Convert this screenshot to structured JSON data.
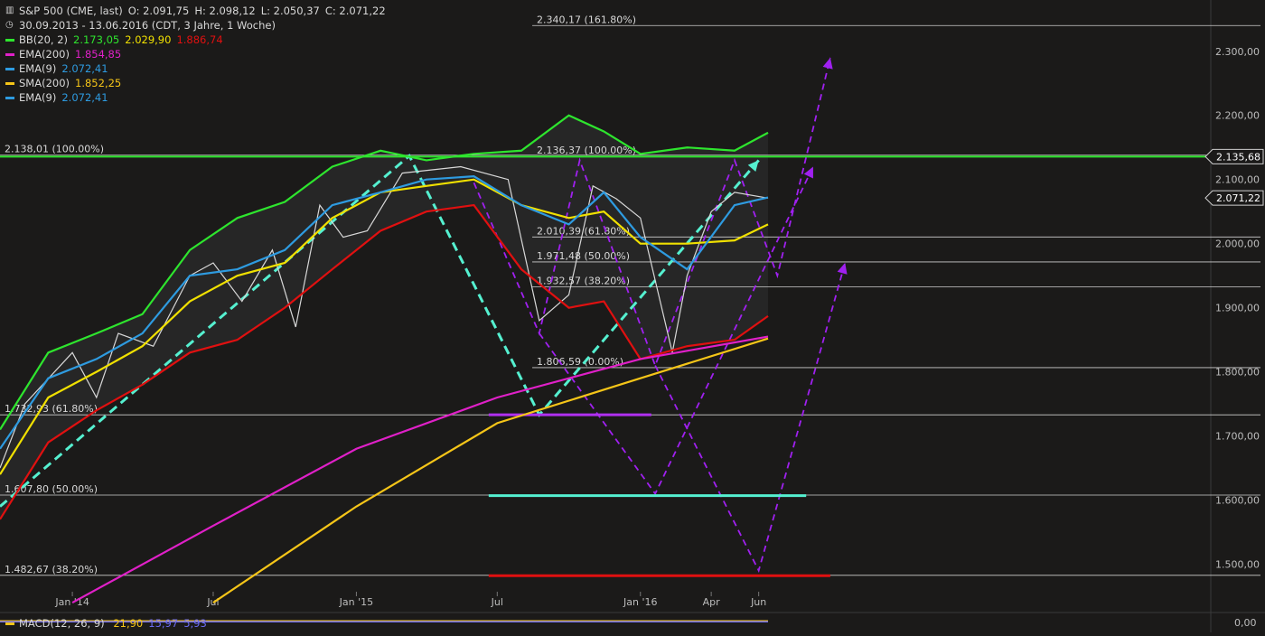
{
  "header": {
    "title": "S&P 500 (CME, last)",
    "ohlc": {
      "open": "O: 2.091,75",
      "high": "H: 2.098,12",
      "low": "L: 2.050,37",
      "close": "C: 2.071,22"
    },
    "range": "30.09.2013 - 13.06.2016 (CDT, 3 Jahre, 1 Woche)"
  },
  "legend": [
    {
      "label": "BB(20, 2)",
      "values": [
        "2.173,05",
        "2.029,90",
        "1.886,74"
      ],
      "colors": [
        "#2ee52e",
        "#f0e000",
        "#e01010"
      ]
    },
    {
      "label": "EMA(200)",
      "values": [
        "1.854,85"
      ],
      "colors": [
        "#e020c8"
      ]
    },
    {
      "label": "EMA(9)",
      "values": [
        "2.072,41"
      ],
      "colors": [
        "#2e9be0"
      ]
    },
    {
      "label": "SMA(200)",
      "values": [
        "1.852,25"
      ],
      "colors": [
        "#f5c518"
      ]
    },
    {
      "label": "EMA(9)",
      "values": [
        "2.072,41"
      ],
      "colors": [
        "#2e9be0"
      ]
    }
  ],
  "macd": {
    "label": "MACD(12, 26, 9)",
    "values": [
      "21,90",
      "15,97",
      "5,93"
    ],
    "colors": [
      "#f5c518",
      "#6b6bf0",
      "#6b6bf0"
    ],
    "axis_label": "0,00"
  },
  "chart_data": {
    "type": "line",
    "title": "S&P 500 (CME, last)",
    "period": "30.09.2013 - 13.06.2016",
    "ylim": [
      1450,
      2380
    ],
    "y_ticks": [
      1500,
      1600,
      1700,
      1800,
      1900,
      2000,
      2100,
      2200,
      2300
    ],
    "y_tick_labels": [
      "1.500,00",
      "1.600,00",
      "1.700,00",
      "1.800,00",
      "1.900,00",
      "2.000,00",
      "2.100,00",
      "2.200,00",
      "2.300,00"
    ],
    "x_ticks": [
      "2014-01-01",
      "2014-07-01",
      "2015-01-01",
      "2015-07-01",
      "2016-01-01",
      "2016-04-01",
      "2016-06-01"
    ],
    "x_tick_labels": [
      "Jan '14",
      "Jul",
      "Jan '15",
      "Jul",
      "Jan '16",
      "Apr",
      "Jun"
    ],
    "xlim": [
      "2013-09-30",
      "2016-06-13"
    ],
    "price_markers": [
      {
        "value": 2135.68,
        "label": "2.135,68",
        "color": "#2ee52e"
      },
      {
        "value": 2071.22,
        "label": "2.071,22",
        "color": "#d8d8d8"
      }
    ],
    "fib_levels": [
      {
        "value": 2340.17,
        "label": "2.340,17 (161.80%)",
        "start": "2015-08-15"
      },
      {
        "value": 2138.01,
        "label": "2.138,01 (100.00%)",
        "start": "2013-09-30"
      },
      {
        "value": 2136.37,
        "label": "2.136,37 (100.00%)",
        "start": "2015-08-15"
      },
      {
        "value": 2010.39,
        "label": "2.010,39 (61.80%)",
        "start": "2015-08-15"
      },
      {
        "value": 1971.48,
        "label": "1.971,48 (50.00%)",
        "start": "2015-08-15"
      },
      {
        "value": 1932.57,
        "label": "1.932,57 (38.20%)",
        "start": "2015-08-15"
      },
      {
        "value": 1806.59,
        "label": "1.806,59 (0.00%)",
        "start": "2015-08-15"
      },
      {
        "value": 1732.93,
        "label": "1.732,93 (61.80%)",
        "start": "2013-09-30"
      },
      {
        "value": 1607.8,
        "label": "1.607,80 (50.00%)",
        "start": "2013-09-30"
      },
      {
        "value": 1482.67,
        "label": "1.482,67 (38.20%)",
        "start": "2013-09-30"
      }
    ],
    "series": [
      {
        "name": "S&P 500 (CME, last)",
        "color": "#d8d8d8",
        "x": [
          "2013-09-30",
          "2013-11-01",
          "2014-01-01",
          "2014-02-01",
          "2014-03-01",
          "2014-04-15",
          "2014-06-01",
          "2014-07-01",
          "2014-08-07",
          "2014-09-15",
          "2014-10-15",
          "2014-11-15",
          "2014-12-15",
          "2015-01-15",
          "2015-03-01",
          "2015-05-15",
          "2015-07-15",
          "2015-08-24",
          "2015-10-01",
          "2015-11-01",
          "2015-12-01",
          "2016-01-01",
          "2016-02-11",
          "2016-03-01",
          "2016-04-01",
          "2016-05-01",
          "2016-06-13"
        ],
        "values": [
          1650,
          1750,
          1830,
          1760,
          1860,
          1840,
          1950,
          1970,
          1910,
          1990,
          1870,
          2060,
          2010,
          2020,
          2110,
          2120,
          2100,
          1880,
          1920,
          2090,
          2070,
          2040,
          1830,
          1950,
          2050,
          2080,
          2071
        ]
      },
      {
        "name": "BB(20, 2)",
        "color": "#2ee52e",
        "x": [
          "2013-09-30",
          "2013-12-01",
          "2014-02-01",
          "2014-04-01",
          "2014-06-01",
          "2014-08-01",
          "2014-10-01",
          "2014-12-01",
          "2015-02-01",
          "2015-04-01",
          "2015-06-01",
          "2015-08-01",
          "2015-10-01",
          "2015-11-15",
          "2016-01-01",
          "2016-03-01",
          "2016-05-01",
          "2016-06-13"
        ],
        "values": [
          1710,
          1830,
          1860,
          1890,
          1990,
          2040,
          2065,
          2120,
          2145,
          2130,
          2140,
          2145,
          2200,
          2175,
          2140,
          2150,
          2145,
          2173
        ]
      },
      {
        "name": "BB(20, 2)",
        "color": "#f0e000",
        "x": [
          "2013-09-30",
          "2013-12-01",
          "2014-02-01",
          "2014-04-01",
          "2014-06-01",
          "2014-08-01",
          "2014-10-01",
          "2014-12-01",
          "2015-02-01",
          "2015-04-01",
          "2015-06-01",
          "2015-08-01",
          "2015-10-01",
          "2015-11-15",
          "2016-01-01",
          "2016-03-01",
          "2016-05-01",
          "2016-06-13"
        ],
        "values": [
          1640,
          1760,
          1800,
          1840,
          1910,
          1950,
          1970,
          2040,
          2080,
          2090,
          2100,
          2060,
          2040,
          2050,
          2000,
          2000,
          2005,
          2030
        ]
      },
      {
        "name": "BB(20, 2)",
        "color": "#e01010",
        "x": [
          "2013-09-30",
          "2013-12-01",
          "2014-02-01",
          "2014-04-01",
          "2014-06-01",
          "2014-08-01",
          "2014-10-01",
          "2014-12-01",
          "2015-02-01",
          "2015-04-01",
          "2015-06-01",
          "2015-08-01",
          "2015-10-01",
          "2015-11-15",
          "2016-01-01",
          "2016-03-01",
          "2016-05-01",
          "2016-06-13"
        ],
        "values": [
          1570,
          1690,
          1740,
          1780,
          1830,
          1850,
          1900,
          1960,
          2020,
          2050,
          2060,
          1960,
          1900,
          1910,
          1820,
          1840,
          1850,
          1887
        ]
      },
      {
        "name": "EMA(9)",
        "color": "#2e9be0",
        "x": [
          "2013-09-30",
          "2013-12-01",
          "2014-02-01",
          "2014-04-01",
          "2014-06-01",
          "2014-08-01",
          "2014-10-01",
          "2014-12-01",
          "2015-02-01",
          "2015-04-01",
          "2015-06-01",
          "2015-08-01",
          "2015-10-01",
          "2015-11-15",
          "2016-01-01",
          "2016-03-01",
          "2016-05-01",
          "2016-06-13"
        ],
        "values": [
          1680,
          1790,
          1820,
          1860,
          1950,
          1960,
          1990,
          2060,
          2080,
          2100,
          2105,
          2060,
          2030,
          2080,
          2010,
          1960,
          2060,
          2072
        ]
      },
      {
        "name": "EMA(200)",
        "color": "#e020c8",
        "x": [
          "2014-01-01",
          "2014-07-01",
          "2015-01-01",
          "2015-07-01",
          "2016-01-01",
          "2016-06-13"
        ],
        "values": [
          1440,
          1560,
          1680,
          1760,
          1820,
          1855
        ]
      },
      {
        "name": "SMA(200)",
        "color": "#f5c518",
        "x": [
          "2014-07-01",
          "2015-01-01",
          "2015-07-01",
          "2016-01-01",
          "2016-06-13"
        ],
        "values": [
          1440,
          1590,
          1720,
          1790,
          1852
        ]
      }
    ],
    "drawings": [
      {
        "kind": "channel",
        "color": "#55f0d0",
        "points": [
          [
            "2013-09-30",
            1590
          ],
          [
            "2015-03-10",
            2137
          ],
          [
            "2015-08-24",
            1733
          ],
          [
            "2016-06-01",
            2130
          ]
        ]
      },
      {
        "kind": "path",
        "color": "#a020f0",
        "points": [
          [
            "2015-06-01",
            2095
          ],
          [
            "2015-08-24",
            1860
          ],
          [
            "2015-10-15",
            2130
          ],
          [
            "2016-01-20",
            1810
          ],
          [
            "2016-05-01",
            2130
          ],
          [
            "2016-06-25",
            1950
          ],
          [
            "2016-09-01",
            2290
          ]
        ]
      },
      {
        "kind": "path",
        "color": "#a020f0",
        "points": [
          [
            "2015-08-24",
            1860
          ],
          [
            "2016-01-20",
            1610
          ],
          [
            "2016-08-10",
            2120
          ]
        ]
      },
      {
        "kind": "path",
        "color": "#a020f0",
        "points": [
          [
            "2016-01-20",
            1810
          ],
          [
            "2016-06-01",
            1490
          ],
          [
            "2016-09-20",
            1970
          ]
        ]
      },
      {
        "kind": "hline",
        "color": "#b030f0",
        "value": 1733,
        "from": "2015-06-20",
        "to": "2016-01-15"
      },
      {
        "kind": "hline",
        "color": "#55f0d0",
        "value": 1607,
        "from": "2015-06-20",
        "to": "2016-08-01"
      },
      {
        "kind": "hline",
        "color": "#e01010",
        "value": 1482,
        "from": "2015-06-20",
        "to": "2016-09-01"
      }
    ]
  }
}
